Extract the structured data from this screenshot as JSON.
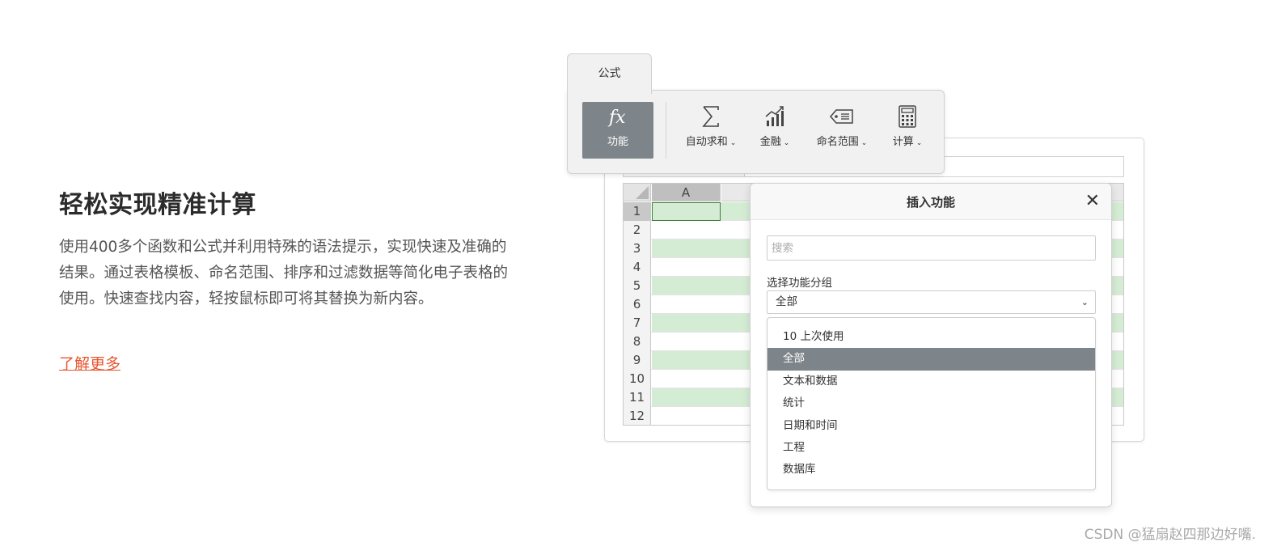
{
  "hero": {
    "title": "轻松实现精准计算",
    "description": "使用400多个函数和公式并利用特殊的语法提示，实现快速及准确的结果。通过表格模板、命名范围、排序和过滤数据等简化电子表格的使用。快速查找内容，轻按鼠标即可将其替换为新内容。",
    "learn_more": "了解更多"
  },
  "colors": {
    "accent": "#e8542c",
    "fx_active": "#7e858a",
    "row_stripe": "#d5ecd4"
  },
  "ribbon": {
    "tab_label": "公式",
    "tools": [
      {
        "label": "功能",
        "icon": "fx-icon",
        "glyph": "fx",
        "dropdown": false
      },
      {
        "label": "自动求和",
        "icon": "sigma-icon",
        "glyph": "∑",
        "dropdown": true
      },
      {
        "label": "金融",
        "icon": "finance-chart-icon",
        "glyph": "📈",
        "dropdown": true
      },
      {
        "label": "命名范围",
        "icon": "tag-icon",
        "glyph": "🏷",
        "dropdown": true
      },
      {
        "label": "计算",
        "icon": "calculator-icon",
        "glyph": "🖩",
        "dropdown": true
      }
    ],
    "chevron": "⌄"
  },
  "sheet": {
    "columns": [
      "A"
    ],
    "rows": [
      "1",
      "2",
      "3",
      "4",
      "5",
      "6",
      "7",
      "8",
      "9",
      "10",
      "11",
      "12"
    ]
  },
  "dialog": {
    "title": "插入功能",
    "close": "✕",
    "search_placeholder": "搜索",
    "group_label": "选择功能分组",
    "group_value": "全部",
    "select_arrow": "⌄",
    "options": [
      "10 上次使用",
      "全部",
      "文本和数据",
      "统计",
      "日期和时间",
      "工程",
      "数据库"
    ],
    "selected_option": "全部"
  },
  "watermark": "CSDN @猛扇赵四那边好嘴."
}
